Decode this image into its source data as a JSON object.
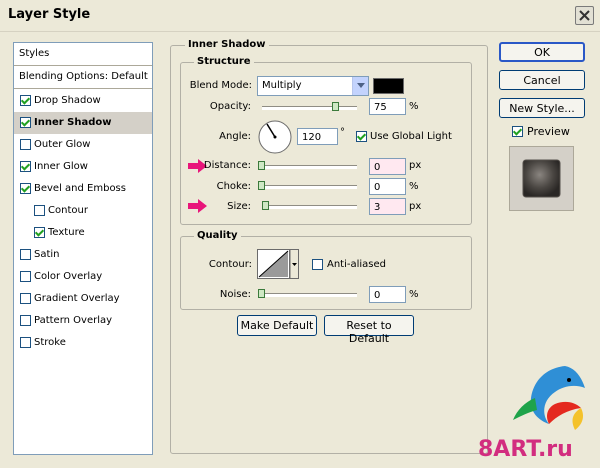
{
  "window": {
    "title": "Layer Style"
  },
  "styles_panel": {
    "header": "Styles",
    "blending_options": "Blending Options: Default",
    "items": [
      {
        "label": "Drop Shadow",
        "checked": true,
        "active": false,
        "indent": false
      },
      {
        "label": "Inner Shadow",
        "checked": true,
        "active": true,
        "indent": false
      },
      {
        "label": "Outer Glow",
        "checked": false,
        "active": false,
        "indent": false
      },
      {
        "label": "Inner Glow",
        "checked": true,
        "active": false,
        "indent": false
      },
      {
        "label": "Bevel and Emboss",
        "checked": true,
        "active": false,
        "indent": false
      },
      {
        "label": "Contour",
        "checked": false,
        "active": false,
        "indent": true
      },
      {
        "label": "Texture",
        "checked": true,
        "active": false,
        "indent": true
      },
      {
        "label": "Satin",
        "checked": false,
        "active": false,
        "indent": false
      },
      {
        "label": "Color Overlay",
        "checked": false,
        "active": false,
        "indent": false
      },
      {
        "label": "Gradient Overlay",
        "checked": false,
        "active": false,
        "indent": false
      },
      {
        "label": "Pattern Overlay",
        "checked": false,
        "active": false,
        "indent": false
      },
      {
        "label": "Stroke",
        "checked": false,
        "active": false,
        "indent": false
      }
    ]
  },
  "inner_shadow": {
    "section_title": "Inner Shadow",
    "structure": {
      "title": "Structure",
      "blend_mode_label": "Blend Mode:",
      "blend_mode_value": "Multiply",
      "shadow_color": "#000000",
      "opacity_label": "Opacity:",
      "opacity_value": "75",
      "opacity_unit": "%",
      "opacity_level": 0.75,
      "angle_label": "Angle:",
      "angle_value": "120",
      "angle_unit": "°",
      "use_global_light_label": "Use Global Light",
      "use_global_light": true,
      "distance_label": "Distance:",
      "distance_value": "0",
      "distance_unit": "px",
      "choke_label": "Choke:",
      "choke_value": "0",
      "choke_unit": "%",
      "size_label": "Size:",
      "size_value": "3",
      "size_unit": "px"
    },
    "quality": {
      "title": "Quality",
      "contour_label": "Contour:",
      "anti_aliased_label": "Anti-aliased",
      "anti_aliased": false,
      "noise_label": "Noise:",
      "noise_value": "0",
      "noise_unit": "%"
    },
    "make_default_label": "Make Default",
    "reset_default_label": "Reset to Default"
  },
  "right_buttons": {
    "ok_label": "OK",
    "cancel_label": "Cancel",
    "new_style_label": "New Style...",
    "preview_label": "Preview",
    "preview_checked": true
  },
  "watermark": {
    "text": "8ART.ru"
  },
  "colors": {
    "highlight_arrow": "#e8157a",
    "accent_border": "#2a58c7"
  }
}
